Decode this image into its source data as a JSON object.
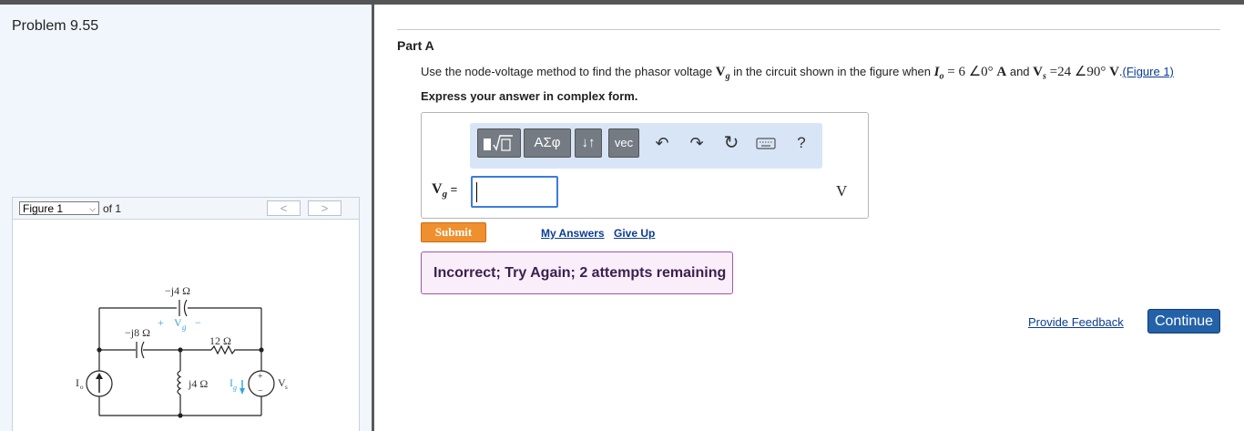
{
  "problem": {
    "title": "Problem 9.55"
  },
  "figure_panel": {
    "selector_value": "Figure 1",
    "of_label": "of 1",
    "prev_glyph": "<",
    "next_glyph": ">"
  },
  "circuit": {
    "top_cap": "−j4 Ω",
    "left_cap": "−j8 Ω",
    "resistor": "12 Ω",
    "inductor": "j4 Ω",
    "vg_label": "V",
    "vg_sub": "g",
    "plus": "+",
    "minus": "−",
    "io_label": "I",
    "io_sub": "o",
    "ig_label": "I",
    "ig_sub": "g",
    "vs_label": "V",
    "vs_sub": "s"
  },
  "part": {
    "title": "Part A"
  },
  "question": {
    "text_before": "Use the node-voltage method to find the phasor voltage ",
    "vg": "V",
    "vg_sub": "g",
    "mid1": " in the circuit shown in the figure when ",
    "io": "I",
    "io_sub": "o",
    "io_value": " = 6 ∠0° ",
    "amp": "A",
    "and": " and ",
    "vs": "V",
    "vs_sub": "s",
    "vs_value": " =24 ∠90° ",
    "volt": "V",
    "period": ".",
    "figure_link": "(Figure 1)"
  },
  "instruction": "Express your answer in complex form.",
  "toolbar": {
    "templates_icon": "templates-icon",
    "symbols_label": "ΑΣφ",
    "updown_label": "↓↑",
    "vec_label": "vec",
    "undo_glyph": "↶",
    "redo_glyph": "↷",
    "reset_glyph": "↻",
    "keyboard_icon": "keyboard-icon",
    "help_label": "?"
  },
  "answer": {
    "label": "V",
    "label_sub": "g",
    "equals": " =",
    "value": "",
    "unit": "V"
  },
  "actions": {
    "submit": "Submit",
    "my_answers": "My Answers",
    "give_up": "Give Up"
  },
  "feedback": {
    "message": "Incorrect; Try Again; 2 attempts remaining"
  },
  "footer": {
    "provide_feedback": "Provide Feedback",
    "continue": "Continue"
  },
  "colors": {
    "submit": "#ef8f2d",
    "continue": "#2361a8",
    "feedback_bg": "#fbeefb",
    "circuit_blue": "#3aa6d8"
  }
}
